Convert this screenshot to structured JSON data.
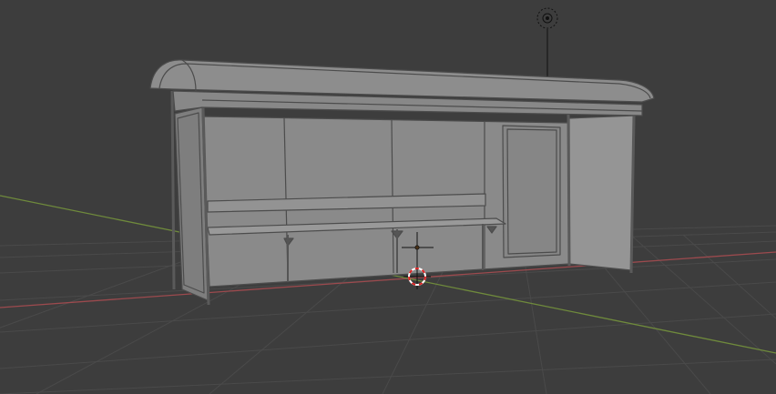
{
  "viewport": {
    "background_color": "#3d3d3d",
    "grid_color": "#4a4a4a",
    "x_axis_color": "#9c4a4e",
    "y_axis_color": "#6f8a3c",
    "model_fill": "#8a8a8a",
    "model_edge": "#4c4c4c"
  },
  "icons": {
    "light": "light-object-icon",
    "cursor": "3d-cursor-icon",
    "origin": "object-origin-icon"
  }
}
